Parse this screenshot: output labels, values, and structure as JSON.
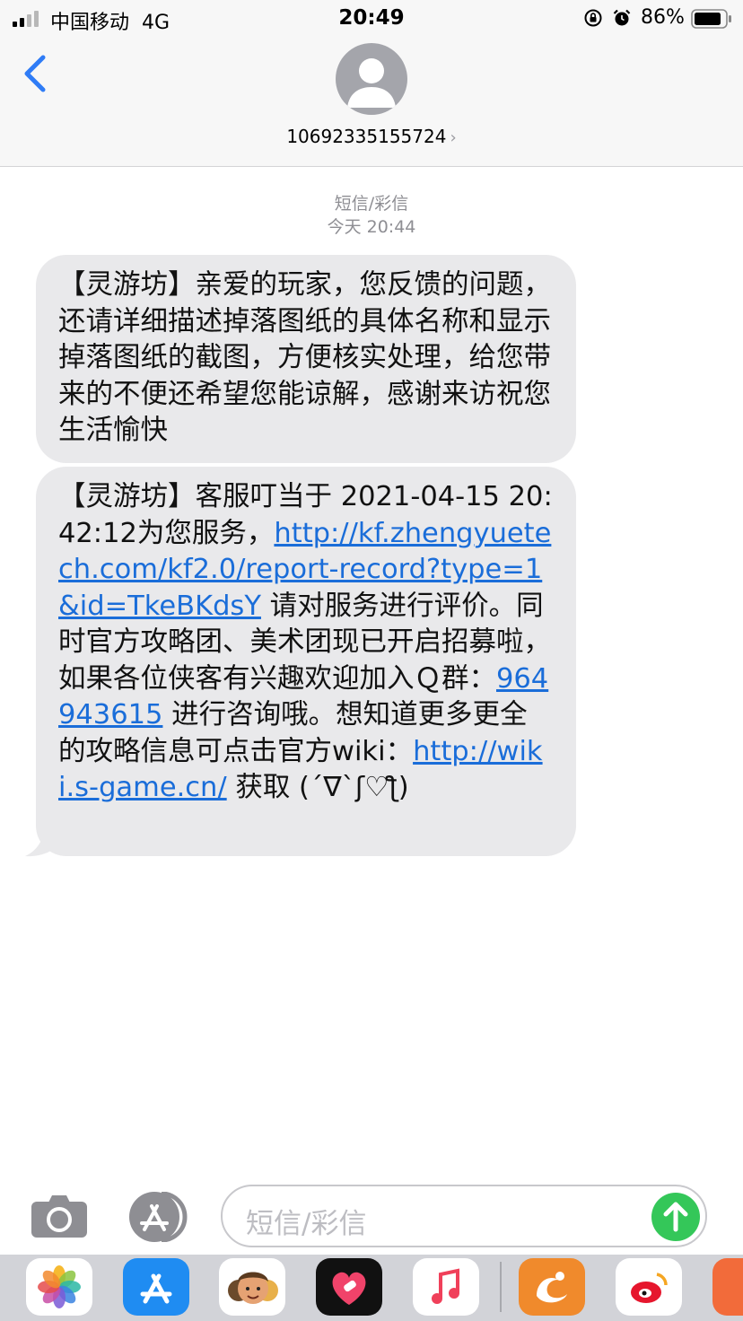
{
  "status_bar": {
    "carrier": "中国移动",
    "network": "4G",
    "time": "20:49",
    "battery_percent": "86%",
    "icons": [
      "signal-icon",
      "rotation-lock-icon",
      "alarm-icon",
      "battery-icon"
    ]
  },
  "header": {
    "contact_number": "10692335155724",
    "chevron": "›",
    "icons": [
      "back-chevron-icon",
      "contact-avatar-icon"
    ]
  },
  "thread": {
    "service_label": "短信/彩信",
    "timestamp": "今天 20:44",
    "messages": [
      {
        "text": "【灵游坊】亲爱的玩家，您反馈的问题，还请详细描述掉落图纸的具体名称和显示掉落图纸的截图，方便核实处理，给您带来的不便还希望您能谅解，感谢来访祝您生活愉快"
      },
      {
        "text_1": "【灵游坊】客服叮当于 2021-04-15 20:42:12为您服务，",
        "link_1": "http://kf.zhengyuetech.com/kf2.0/report-record?type=1&id=TkeBKdsY",
        "text_2": " 请对服务进行评价。同时官方攻略团、美术团现已开启招募啦，如果各位侠客有兴趣欢迎加入Ｑ群：",
        "link_2": "964943615",
        "text_3": " 进行咨询哦。想知道更多更全的攻略信息可点击官方wiki：",
        "link_3": "http://wiki.s-game.cn/",
        "text_4": " 获取 (´∇`ʃ♡ƪ)"
      }
    ]
  },
  "input_bar": {
    "placeholder": "短信/彩信",
    "icons": [
      "camera-icon",
      "app-store-icon",
      "send-arrow-icon"
    ]
  },
  "app_drawer": {
    "apps": [
      "photos-app-icon",
      "app-store-app-icon",
      "memoji-app-icon",
      "heart-app-icon",
      "music-app-icon",
      "uc-browser-app-icon",
      "weibo-app-icon",
      "partial-app-icon"
    ]
  },
  "colors": {
    "link": "#1a6dd9",
    "bubble": "#e9e9eb",
    "send": "#34c759",
    "accent": "#2f7cf6"
  }
}
